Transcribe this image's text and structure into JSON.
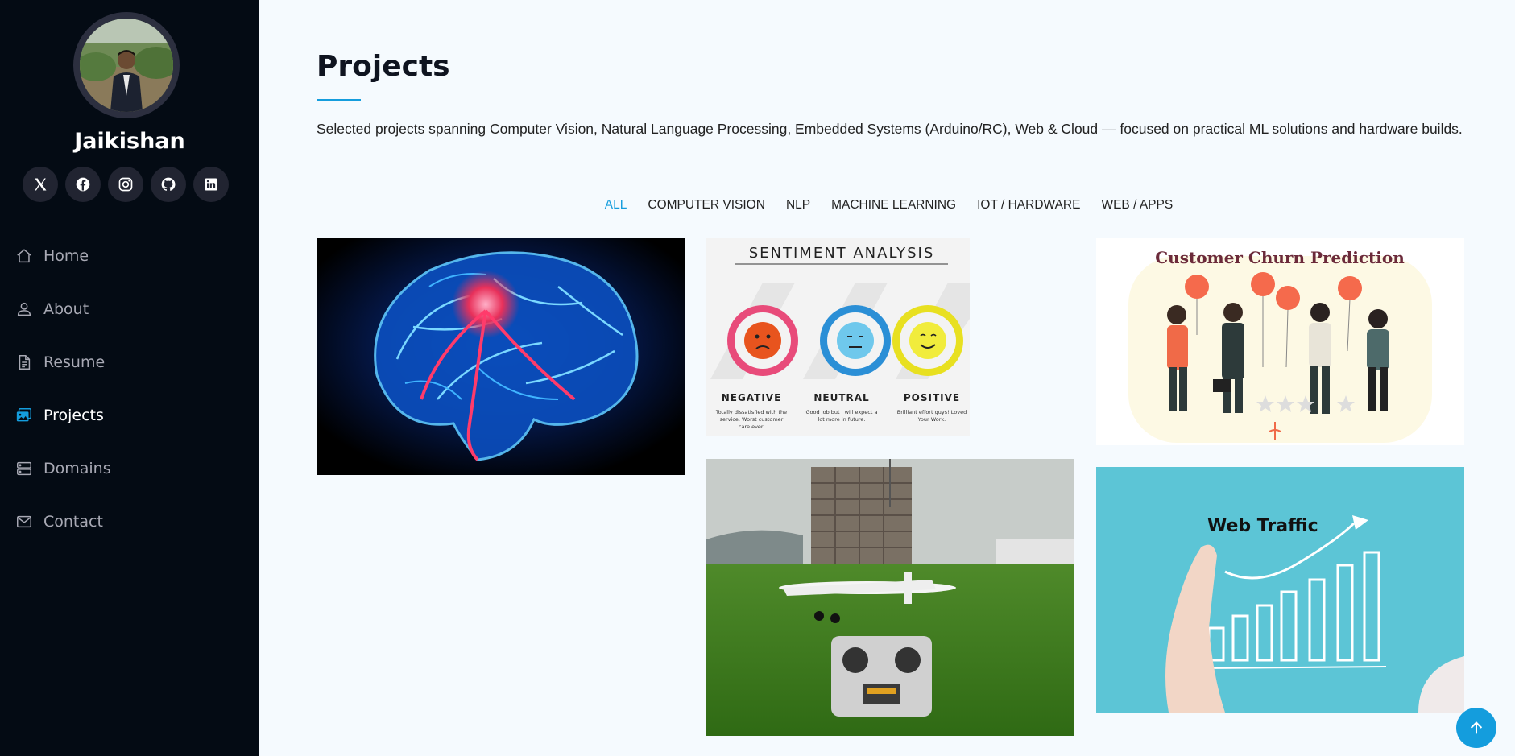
{
  "profile": {
    "name": "Jaikishan"
  },
  "socials": [
    {
      "icon": "x-twitter-icon"
    },
    {
      "icon": "facebook-icon"
    },
    {
      "icon": "instagram-icon"
    },
    {
      "icon": "github-icon"
    },
    {
      "icon": "linkedin-icon"
    }
  ],
  "nav": {
    "items": [
      {
        "label": "Home",
        "icon": "house-icon"
      },
      {
        "label": "About",
        "icon": "person-icon"
      },
      {
        "label": "Resume",
        "icon": "document-icon"
      },
      {
        "label": "Projects",
        "icon": "images-icon",
        "active": true
      },
      {
        "label": "Domains",
        "icon": "server-icon"
      },
      {
        "label": "Contact",
        "icon": "envelope-icon"
      }
    ]
  },
  "main": {
    "title": "Projects",
    "description": "Selected projects spanning Computer Vision, Natural Language Processing, Embedded Systems (Arduino/RC), Web & Cloud — focused on practical ML solutions and hardware builds.",
    "filters": [
      "ALL",
      "COMPUTER VISION",
      "NLP",
      "MACHINE LEARNING",
      "IOT / HARDWARE",
      "WEB / APPS"
    ],
    "active_filter": "ALL"
  },
  "cards": {
    "sentiment": {
      "heading": "SENTIMENT ANALYSIS",
      "negative": "NEGATIVE",
      "neutral": "NEUTRAL",
      "positive": "POSITIVE",
      "neg_text_1": "Totally dissatisfied with the",
      "neg_text_2": "service. Worst customer",
      "neg_text_3": "care ever.",
      "neu_text_1": "Good Job but I will expect a",
      "neu_text_2": "lot more in future.",
      "pos_text_1": "Brilliant effort guys! Loved",
      "pos_text_2": "Your Work."
    },
    "churn": {
      "heading": "Customer Churn Prediction"
    },
    "traffic": {
      "heading": "Web Traffic"
    }
  },
  "colors": {
    "accent": "#149ddd",
    "sidebar_bg": "#040b14",
    "page_bg": "#f5fafe"
  }
}
